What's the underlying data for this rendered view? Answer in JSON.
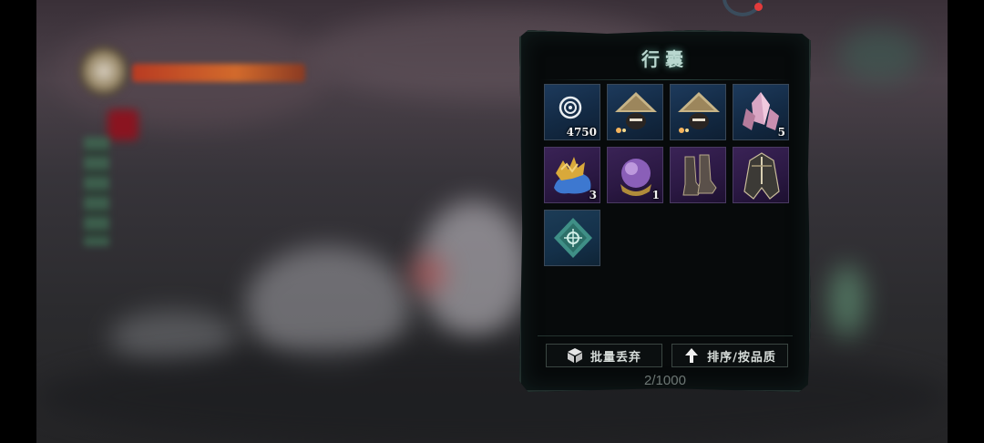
{
  "hud": {
    "accent_ring_color": "#e23b3b"
  },
  "inventory": {
    "title": "行囊",
    "slots": [
      {
        "icon": "silver-coin-icon",
        "quantity": "4750",
        "rarity": "blue"
      },
      {
        "icon": "straw-hat-warrior-icon",
        "quantity": "",
        "rarity": "blue"
      },
      {
        "icon": "straw-hat-warrior-icon",
        "quantity": "",
        "rarity": "blue"
      },
      {
        "icon": "pink-crystal-cluster-icon",
        "quantity": "5",
        "rarity": "blue"
      },
      {
        "icon": "gold-blue-ore-icon",
        "quantity": "3",
        "rarity": "purple"
      },
      {
        "icon": "purple-orb-icon",
        "quantity": "1",
        "rarity": "purple"
      },
      {
        "icon": "armored-boots-icon",
        "quantity": "",
        "rarity": "purple"
      },
      {
        "icon": "armored-cloak-icon",
        "quantity": "",
        "rarity": "purple"
      },
      {
        "icon": "teal-rune-diamond-icon",
        "quantity": "",
        "rarity": "teal"
      }
    ],
    "buttons": {
      "discard_label": "批量丢弃",
      "sort_label": "排序/按品质"
    },
    "capacity": "2/1000"
  },
  "colors": {
    "title_glow": "#b9d7cf",
    "blue_slot": "#1d3a5c",
    "purple_slot": "#3a2356"
  }
}
